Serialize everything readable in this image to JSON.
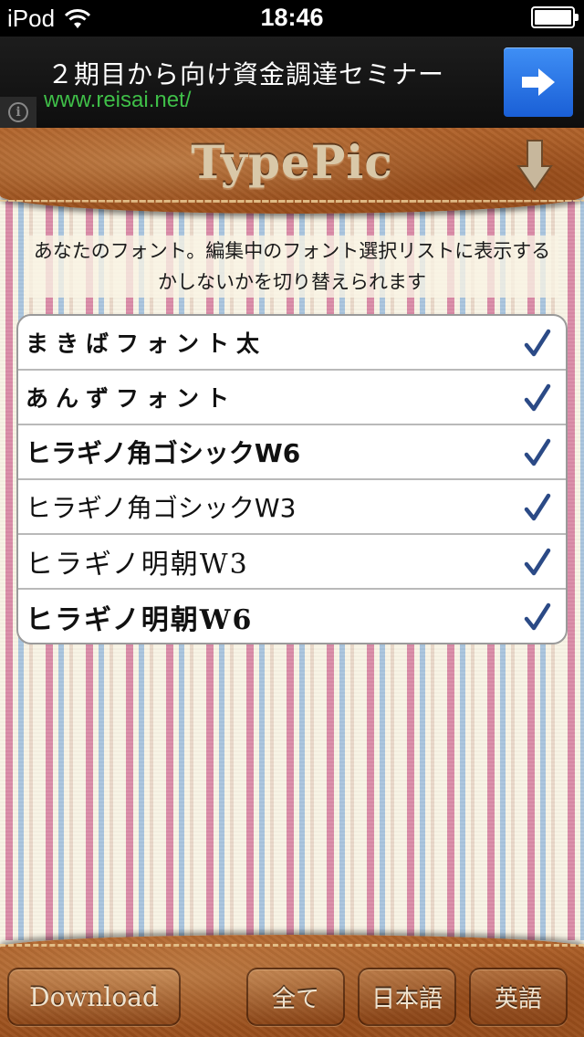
{
  "status_bar": {
    "carrier": "iPod",
    "time": "18:46"
  },
  "ad": {
    "title": "２期目から向け資金調達セミナー",
    "url": "www.reisai.net/",
    "info_icon": "info-icon",
    "arrow_icon": "right-arrow-icon"
  },
  "header": {
    "logo": "TypePic",
    "download_icon": "down-arrow-icon"
  },
  "description": "あなたのフォント。編集中のフォント選択リストに表示するかしないかを切り替えられます",
  "fonts": [
    {
      "name": "まきばフォント太",
      "checked": true
    },
    {
      "name": "あんずフォント",
      "checked": true
    },
    {
      "name": "ヒラギノ角ゴシックW6",
      "checked": true
    },
    {
      "name": "ヒラギノ角ゴシックW3",
      "checked": true
    },
    {
      "name": "ヒラギノ明朝W3",
      "checked": true
    },
    {
      "name": "ヒラギノ明朝W6",
      "checked": true
    }
  ],
  "footer": {
    "download_label": "Download",
    "all_label": "全て",
    "japanese_label": "日本語",
    "english_label": "英語"
  },
  "colors": {
    "check": "#2b4a86",
    "leather": "#a5572a",
    "stitch": "#e8c690",
    "ad_url": "#3fbf48",
    "ad_button": "#2a73e8"
  }
}
